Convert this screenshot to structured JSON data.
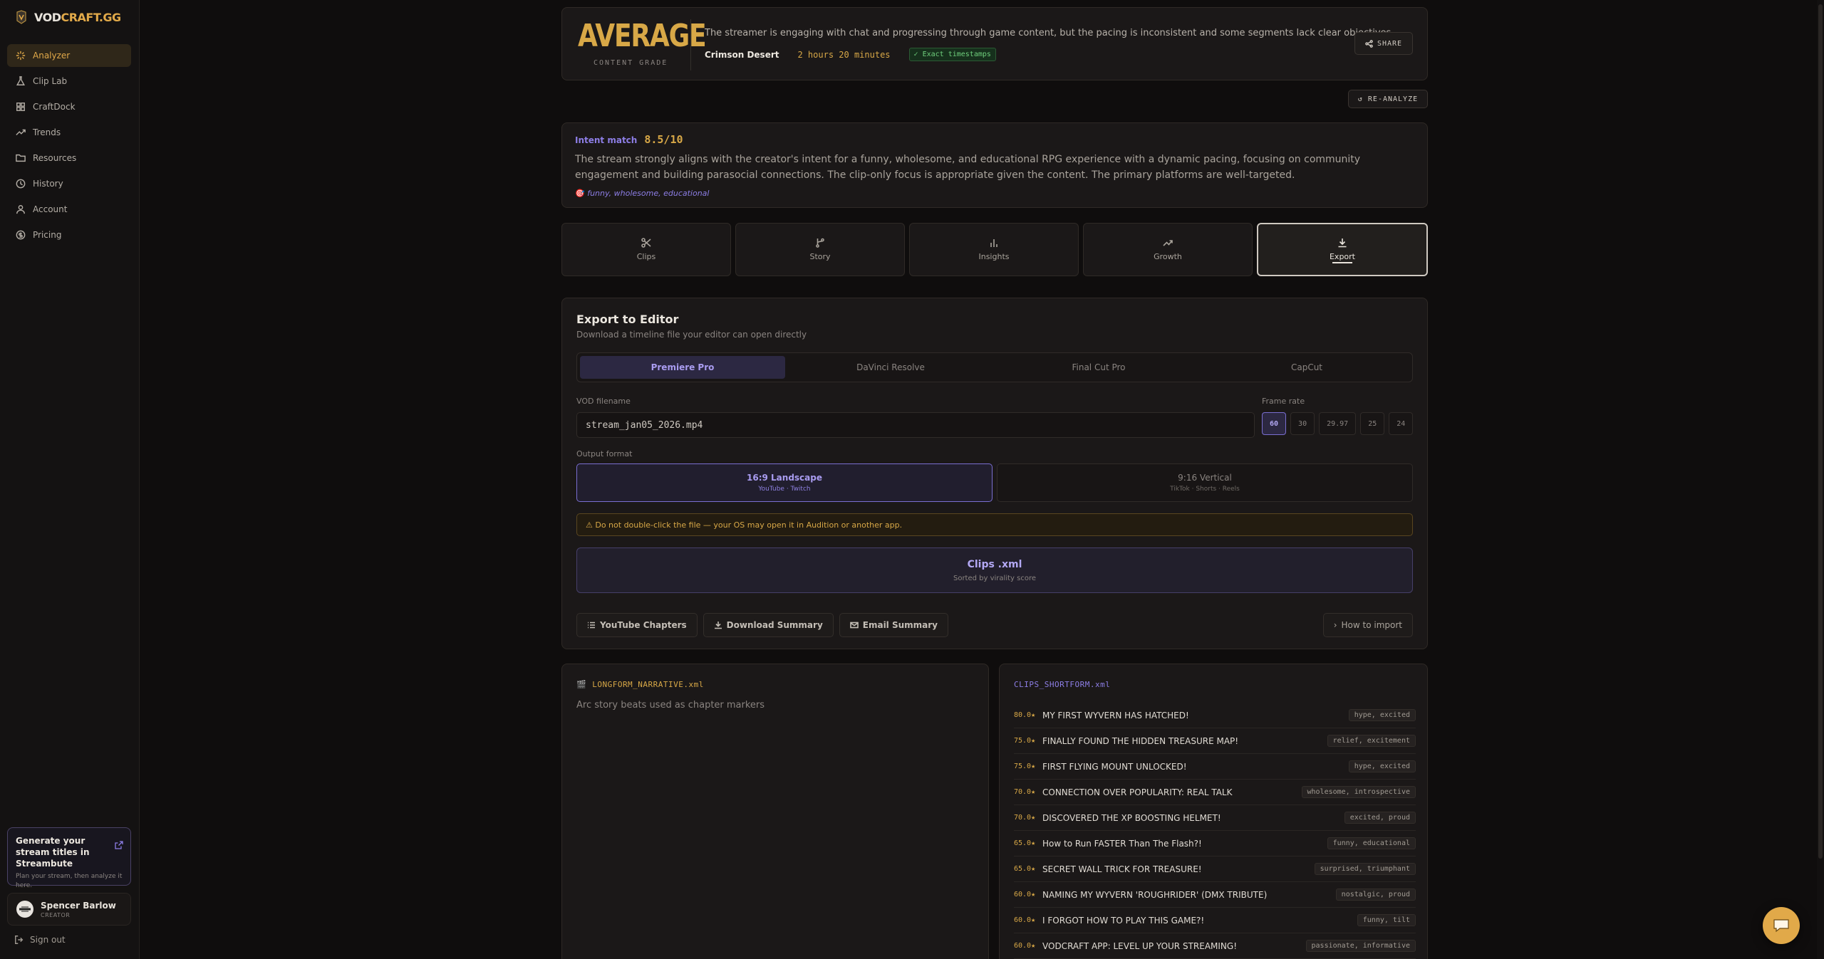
{
  "brand": {
    "prefix": "VOD",
    "suffix": "CRAFT.GG"
  },
  "nav": [
    {
      "label": "Analyzer",
      "icon": "sparkle-icon",
      "active": true
    },
    {
      "label": "Clip Lab",
      "icon": "flask-icon"
    },
    {
      "label": "CraftDock",
      "icon": "grid-icon"
    },
    {
      "label": "Trends",
      "icon": "trend-icon"
    },
    {
      "label": "Resources",
      "icon": "folder-icon"
    },
    {
      "label": "History",
      "icon": "clock-icon"
    },
    {
      "label": "Account",
      "icon": "user-icon"
    },
    {
      "label": "Pricing",
      "icon": "dollar-icon"
    }
  ],
  "promo": {
    "title": "Generate your stream titles in Streambute",
    "subtitle": "Plan your stream, then analyze it here."
  },
  "user": {
    "name": "Spencer Barlow",
    "role": "CREATOR"
  },
  "signout_label": "Sign out",
  "grade": {
    "value": "AVERAGE",
    "label": "CONTENT GRADE",
    "summary": "The streamer is engaging with chat and progressing through game content, but the pacing is inconsistent and some segments lack clear objectives.",
    "game": "Crimson Desert",
    "duration": "2 hours 20 minutes",
    "badge": "✓ Exact timestamps",
    "share_label": "SHARE"
  },
  "reanalyze_label": "↺ RE-ANALYZE",
  "intent": {
    "label": "Intent match",
    "score": "8.5/10",
    "text": "The stream strongly aligns with the creator's intent for a funny, wholesome, and educational RPG experience with a dynamic pacing, focusing on community engagement and building parasocial connections. The clip-only focus is appropriate given the content. The primary platforms are well-targeted.",
    "tags": "funny, wholesome, educational"
  },
  "tabs": [
    {
      "label": "Clips",
      "icon": "scissors-icon"
    },
    {
      "label": "Story",
      "icon": "branch-icon"
    },
    {
      "label": "Insights",
      "icon": "bar-chart-icon"
    },
    {
      "label": "Growth",
      "icon": "trend-up-icon"
    },
    {
      "label": "Export",
      "icon": "download-icon",
      "active": true
    }
  ],
  "export": {
    "title": "Export to Editor",
    "subtitle": "Download a timeline file your editor can open directly",
    "editors": [
      "Premiere Pro",
      "DaVinci Resolve",
      "Final Cut Pro",
      "CapCut"
    ],
    "active_editor": "Premiere Pro",
    "vod_label": "VOD filename",
    "vod_value": "stream_jan05_2026.mp4",
    "framerate_label": "Frame rate",
    "framerates": [
      "60",
      "30",
      "29.97",
      "25",
      "24"
    ],
    "active_framerate": "60",
    "output_label": "Output format",
    "formats": [
      {
        "title": "16:9 Landscape",
        "sub": "YouTube · Twitch",
        "active": true
      },
      {
        "title": "9:16 Vertical",
        "sub": "TikTok · Shorts · Reels"
      }
    ],
    "warning": "⚠ Do not double-click the file — your OS may open it in Audition or another app.",
    "clips_xml": {
      "title": "Clips .xml",
      "sub": "Sorted by virality score"
    },
    "actions": [
      "YouTube Chapters",
      "Download Summary",
      "Email Summary"
    ],
    "howto_label": "How to import"
  },
  "narrative": {
    "file": "LONGFORM_NARRATIVE.xml",
    "subtitle": "Arc story beats used as chapter markers"
  },
  "shortform": {
    "file": "CLIPS_SHORTFORM.xml",
    "clips": [
      {
        "score": "80.0★",
        "title": "MY FIRST WYVERN HAS HATCHED!",
        "tags": "hype, excited"
      },
      {
        "score": "75.0★",
        "title": "FINALLY FOUND THE HIDDEN TREASURE MAP!",
        "tags": "relief, excitement"
      },
      {
        "score": "75.0★",
        "title": "FIRST FLYING MOUNT UNLOCKED!",
        "tags": "hype, excited"
      },
      {
        "score": "70.0★",
        "title": "CONNECTION OVER POPULARITY: REAL TALK",
        "tags": "wholesome, introspective"
      },
      {
        "score": "70.0★",
        "title": "DISCOVERED THE XP BOOSTING HELMET!",
        "tags": "excited, proud"
      },
      {
        "score": "65.0★",
        "title": "How to Run FASTER Than The Flash?!",
        "tags": "funny, educational"
      },
      {
        "score": "65.0★",
        "title": "SECRET WALL TRICK FOR TREASURE!",
        "tags": "surprised, triumphant"
      },
      {
        "score": "60.0★",
        "title": "NAMING MY WYVERN 'ROUGHRIDER' (DMX TRIBUTE)",
        "tags": "nostalgic, proud"
      },
      {
        "score": "60.0★",
        "title": "I FORGOT HOW TO PLAY THIS GAME?!",
        "tags": "funny, tilt"
      },
      {
        "score": "60.0★",
        "title": "VODCRAFT APP: LEVEL UP YOUR STREAMING!",
        "tags": "passionate, informative"
      }
    ]
  },
  "colors": {
    "accent": "#e1a949",
    "purple": "#8d7ee6",
    "bg": "#0f0d0d"
  }
}
